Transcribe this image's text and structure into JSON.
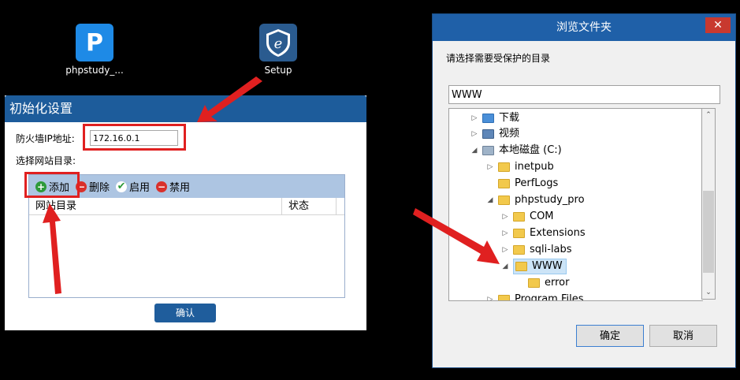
{
  "desktop": {
    "icons": [
      {
        "label": "phpstudy_...",
        "glyph": "P",
        "color": "#1e8ae6"
      },
      {
        "label": "Setup",
        "glyph": "e",
        "color": "#2a5b8f"
      }
    ]
  },
  "init_dialog": {
    "title": "初始化设置",
    "ip_label": "防火墙IP地址:",
    "ip_value": "172.16.0.1",
    "site_dir_label": "选择网站目录:",
    "toolbar": {
      "add": "添加",
      "delete": "删除",
      "enable": "启用",
      "disable": "禁用"
    },
    "columns": [
      "网站目录",
      "状态"
    ],
    "confirm": "确认"
  },
  "browse_dialog": {
    "title": "浏览文件夹",
    "close": "✕",
    "prompt": "请选择需要受保护的目录",
    "path_value": "WWW",
    "tree": [
      {
        "label": "下载",
        "expanded": false
      },
      {
        "label": "视频",
        "expanded": false
      },
      {
        "label": "本地磁盘 (C:)",
        "expanded": true
      },
      {
        "label": "inetpub",
        "expanded": false
      },
      {
        "label": "PerfLogs",
        "expanded": null
      },
      {
        "label": "phpstudy_pro",
        "expanded": true
      },
      {
        "label": "COM",
        "expanded": false
      },
      {
        "label": "Extensions",
        "expanded": false
      },
      {
        "label": "sqli-labs",
        "expanded": false
      },
      {
        "label": "WWW",
        "expanded": true,
        "selected": true
      },
      {
        "label": "error",
        "expanded": null
      },
      {
        "label": "Program Files",
        "expanded": false
      }
    ],
    "ok": "确定",
    "cancel": "取消"
  },
  "colors": {
    "accent_red": "#e02020",
    "title_blue": "#1d5c9b"
  }
}
